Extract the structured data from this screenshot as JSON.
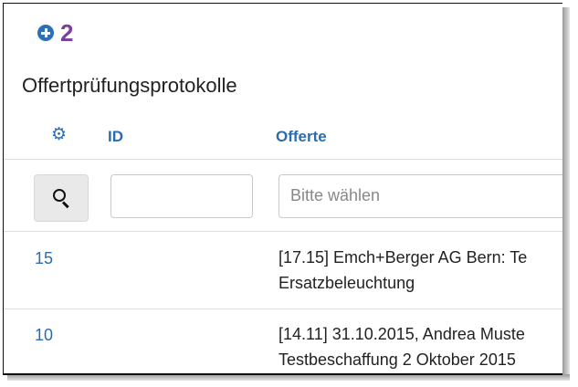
{
  "step": {
    "number": "2"
  },
  "page_title": "Offertprüfungsprotokolle",
  "table": {
    "columns": [
      "ID",
      "Offerte"
    ],
    "filter": {
      "id_value": "",
      "offer_placeholder": "Bitte wählen"
    },
    "rows": [
      {
        "id": "15",
        "line1": "[17.15] Emch+Berger AG Bern: Te",
        "line2": "Ersatzbeleuchtung"
      },
      {
        "id": "10",
        "line1": "[14.11] 31.10.2015, Andrea Muste",
        "line2": "Testbeschaffung 2 Oktober 2015"
      }
    ]
  },
  "colors": {
    "accent": "#2b6cb0",
    "step_number": "#7b3fa0"
  }
}
